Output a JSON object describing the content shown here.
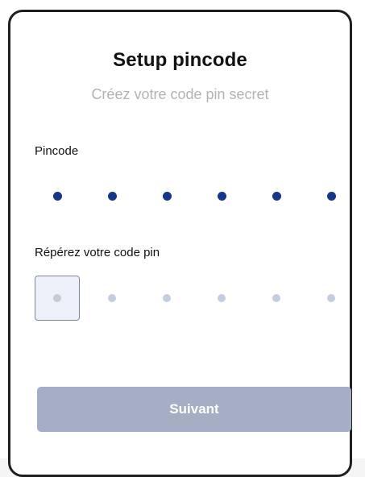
{
  "header": {
    "title": "Setup pincode",
    "subtitle": "Créez votre code pin secret"
  },
  "pincode": {
    "label": "Pincode",
    "digits_filled": 6,
    "digits_total": 6
  },
  "confirm": {
    "label": "Répérez votre code pin",
    "digits_filled": 0,
    "digits_total": 6,
    "focused_slot": 1
  },
  "footer": {
    "next_label": "Suivant"
  },
  "colors": {
    "filled_dot": "#15378b",
    "empty_dot": "#c5cde1",
    "button_disabled": "#a5aec4"
  }
}
